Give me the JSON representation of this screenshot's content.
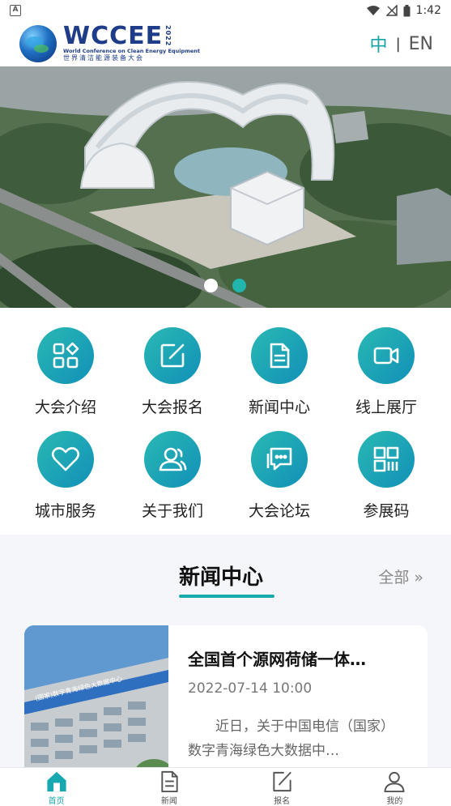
{
  "status_bar": {
    "time": "1:42",
    "badge": "A"
  },
  "header": {
    "logo_mark": "WCCEE",
    "logo_year": "2022",
    "logo_en": "World Conference on Clean Energy Equipment",
    "logo_cn": "世界清洁能源装备大会",
    "lang_cn": "中",
    "lang_sep": "|",
    "lang_en": "EN"
  },
  "banner": {
    "slide_count": 2,
    "active_slide": 2
  },
  "menu": {
    "items": [
      {
        "label": "大会介绍",
        "icon": "grid-apps-icon"
      },
      {
        "label": "大会报名",
        "icon": "edit-form-icon"
      },
      {
        "label": "新闻中心",
        "icon": "document-icon"
      },
      {
        "label": "线上展厅",
        "icon": "video-camera-icon"
      },
      {
        "label": "城市服务",
        "icon": "heart-icon"
      },
      {
        "label": "关于我们",
        "icon": "users-icon"
      },
      {
        "label": "大会论坛",
        "icon": "chat-icon"
      },
      {
        "label": "参展码",
        "icon": "qrcode-icon"
      }
    ]
  },
  "news": {
    "section_title": "新闻中心",
    "all_link": "全部 »",
    "thumb_sign": "(国家)数字青海绿色大数据中心",
    "cards": [
      {
        "title": "全国首个源网荷储一体…",
        "date": "2022-07-14 10:00",
        "summary": "近日，关于中国电信（国家）数字青海绿色大数据中…"
      }
    ]
  },
  "bottom_nav": {
    "items": [
      {
        "label": "首页",
        "icon": "home-icon",
        "active": true
      },
      {
        "label": "新闻",
        "icon": "news-icon",
        "active": false
      },
      {
        "label": "报名",
        "icon": "signup-icon",
        "active": false
      },
      {
        "label": "我的",
        "icon": "profile-icon",
        "active": false
      }
    ]
  },
  "colors": {
    "accent": "#18a8b0",
    "icon_gradient_start": "#2ab9b3",
    "icon_gradient_end": "#1190b8",
    "brand": "#1f3c88"
  }
}
